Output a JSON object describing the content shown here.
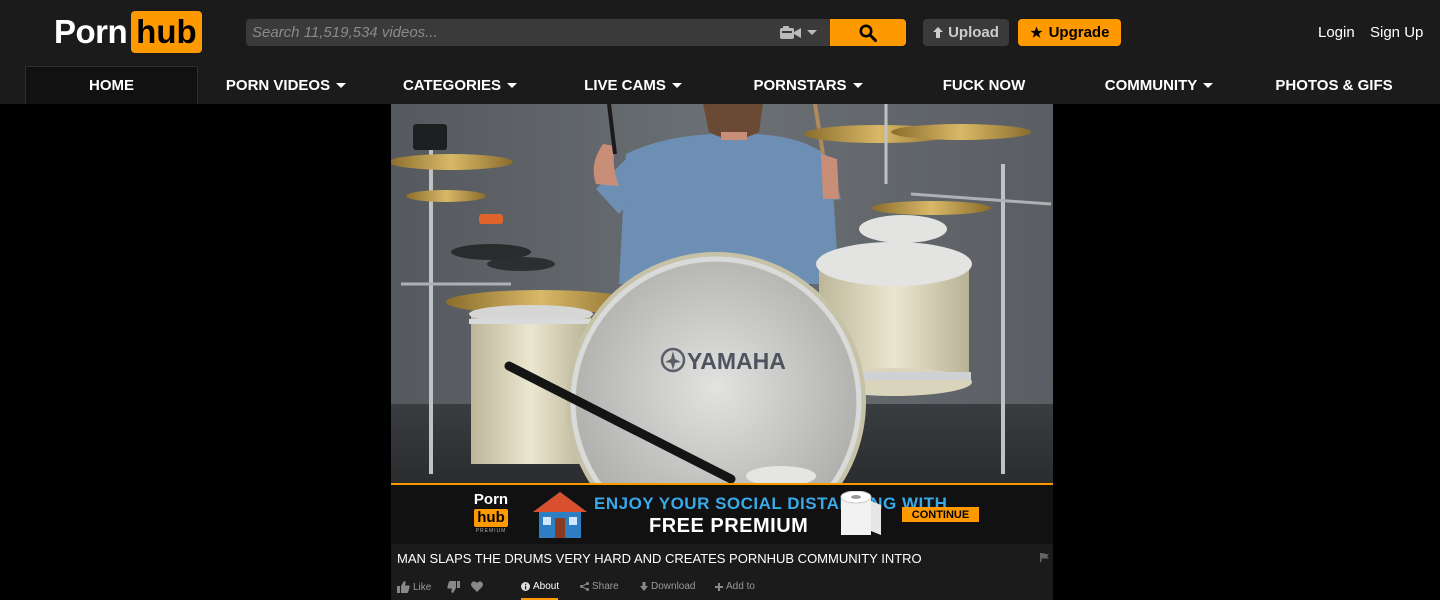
{
  "header": {
    "logo": {
      "part1": "Porn",
      "part2": "hub"
    },
    "search": {
      "placeholder": "Search 11,519,534 videos..."
    },
    "upload_label": "Upload",
    "upgrade_label": "Upgrade",
    "login_label": "Login",
    "signup_label": "Sign Up"
  },
  "nav": {
    "items": [
      {
        "label": "HOME"
      },
      {
        "label": "PORN VIDEOS"
      },
      {
        "label": "CATEGORIES"
      },
      {
        "label": "LIVE CAMS"
      },
      {
        "label": "PORNSTARS"
      },
      {
        "label": "FUCK NOW"
      },
      {
        "label": "COMMUNITY"
      },
      {
        "label": "PHOTOS & GIFS"
      }
    ]
  },
  "player": {
    "drum_brand": "YAMAHA"
  },
  "ad": {
    "logo_part1": "Porn",
    "logo_part2": "hub",
    "logo_sub": "PREMIUM",
    "line1": "ENJOY YOUR SOCIAL DISTANCING WITH",
    "line2": "FREE PREMIUM",
    "cta": "CONTINUE"
  },
  "video": {
    "title": "MAN SLAPS THE DRUMS VERY HARD AND CREATES PORNHUB COMMUNITY INTRO"
  },
  "actions": {
    "like": "Like",
    "about": "About",
    "share": "Share",
    "download": "Download",
    "add_to": "Add to"
  },
  "colors": {
    "accent": "#ff9900",
    "bar": "#1b1b1b",
    "background": "#000000",
    "ad_blue": "#3aa9e8"
  },
  "icons": [
    "camera-icon",
    "search-icon",
    "upload-arrow-icon",
    "star-icon",
    "house-icon",
    "toilet-paper-icon",
    "flag-icon",
    "thumbs-up-icon",
    "thumbs-down-icon",
    "heart-icon",
    "info-icon",
    "share-icon",
    "download-icon",
    "plus-icon"
  ]
}
